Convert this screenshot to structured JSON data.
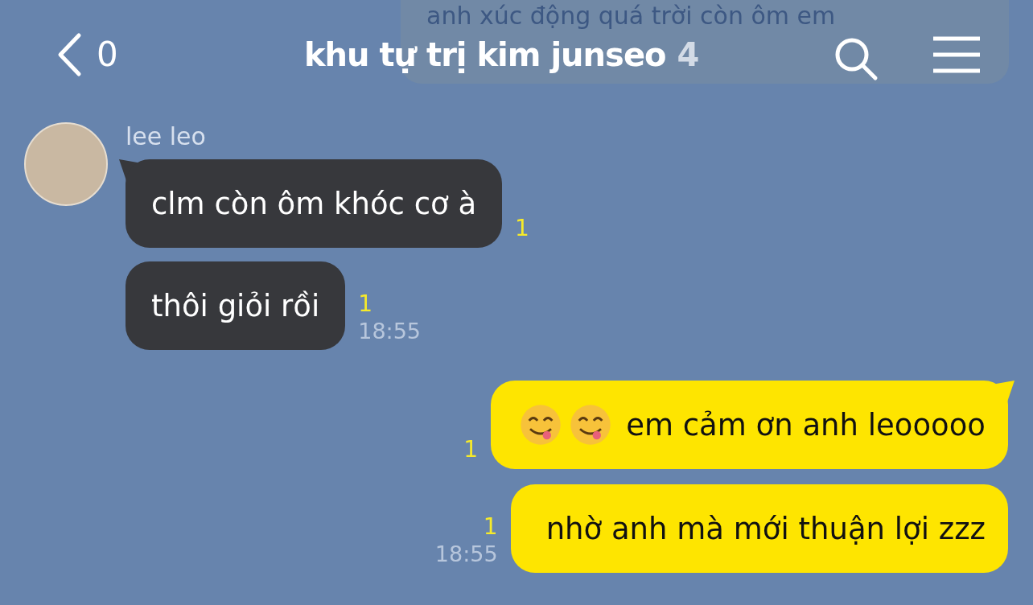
{
  "header": {
    "back_count": "0",
    "title": "khu tự trị kim junseo",
    "member_count": "4"
  },
  "faded_message": {
    "text": "anh xúc động quá trời còn ôm em"
  },
  "groups": [
    {
      "kind": "received",
      "sender": "lee leo",
      "messages": [
        {
          "kind": "text",
          "text": "clm còn ôm khóc cơ à",
          "unread": "1"
        },
        {
          "kind": "text",
          "text": "thôi giỏi rồi",
          "unread": "1",
          "time": "18:55"
        }
      ]
    },
    {
      "kind": "sent",
      "messages": [
        {
          "kind": "double-emoji-text",
          "text": "em cảm ơn anh leooooo",
          "unread": "1"
        },
        {
          "kind": "text",
          "text": "nhờ anh mà mới thuận lợi zzz",
          "unread": "1",
          "time": "18:55"
        }
      ]
    }
  ]
}
